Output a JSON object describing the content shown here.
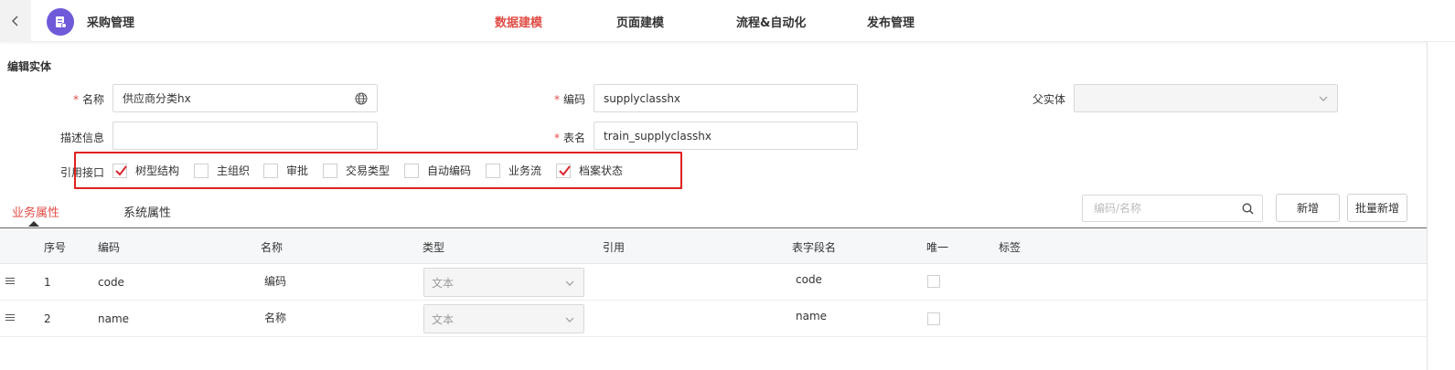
{
  "header": {
    "app_title": "采购管理",
    "nav": [
      {
        "label": "数据建模",
        "active": true
      },
      {
        "label": "页面建模",
        "active": false
      },
      {
        "label": "流程&自动化",
        "active": false
      },
      {
        "label": "发布管理",
        "active": false
      }
    ],
    "accent_color": "#e14c46"
  },
  "form": {
    "section_title": "编辑实体",
    "name": {
      "label": "名称",
      "value": "供应商分类hx",
      "required": true
    },
    "code": {
      "label": "编码",
      "value": "supplyclasshx",
      "required": true
    },
    "parent": {
      "label": "父实体",
      "value": ""
    },
    "description": {
      "label": "描述信息",
      "value": ""
    },
    "table_name": {
      "label": "表名",
      "value": "train_supplyclasshx",
      "required": true
    },
    "interfaces": {
      "label": "引用接口",
      "items": [
        {
          "label": "树型结构",
          "checked": true
        },
        {
          "label": "主组织",
          "checked": false
        },
        {
          "label": "审批",
          "checked": false
        },
        {
          "label": "交易类型",
          "checked": false
        },
        {
          "label": "自动编码",
          "checked": false
        },
        {
          "label": "业务流",
          "checked": false
        },
        {
          "label": "档案状态",
          "checked": true
        }
      ]
    }
  },
  "attr_tabs": [
    {
      "label": "业务属性",
      "active": true
    },
    {
      "label": "系统属性",
      "active": false
    }
  ],
  "toolbar": {
    "search_placeholder": "编码/名称",
    "add_label": "新增",
    "batch_add_label": "批量新增"
  },
  "table": {
    "columns": [
      "序号",
      "编码",
      "名称",
      "类型",
      "引用",
      "表字段名",
      "唯一",
      "标签"
    ],
    "rows": [
      {
        "index": "1",
        "code": "code",
        "name": "编码",
        "type": "文本",
        "ref": "",
        "field": "code",
        "unique": false,
        "tag": ""
      },
      {
        "index": "2",
        "code": "name",
        "name": "名称",
        "type": "文本",
        "ref": "",
        "field": "name",
        "unique": false,
        "tag": ""
      }
    ]
  }
}
